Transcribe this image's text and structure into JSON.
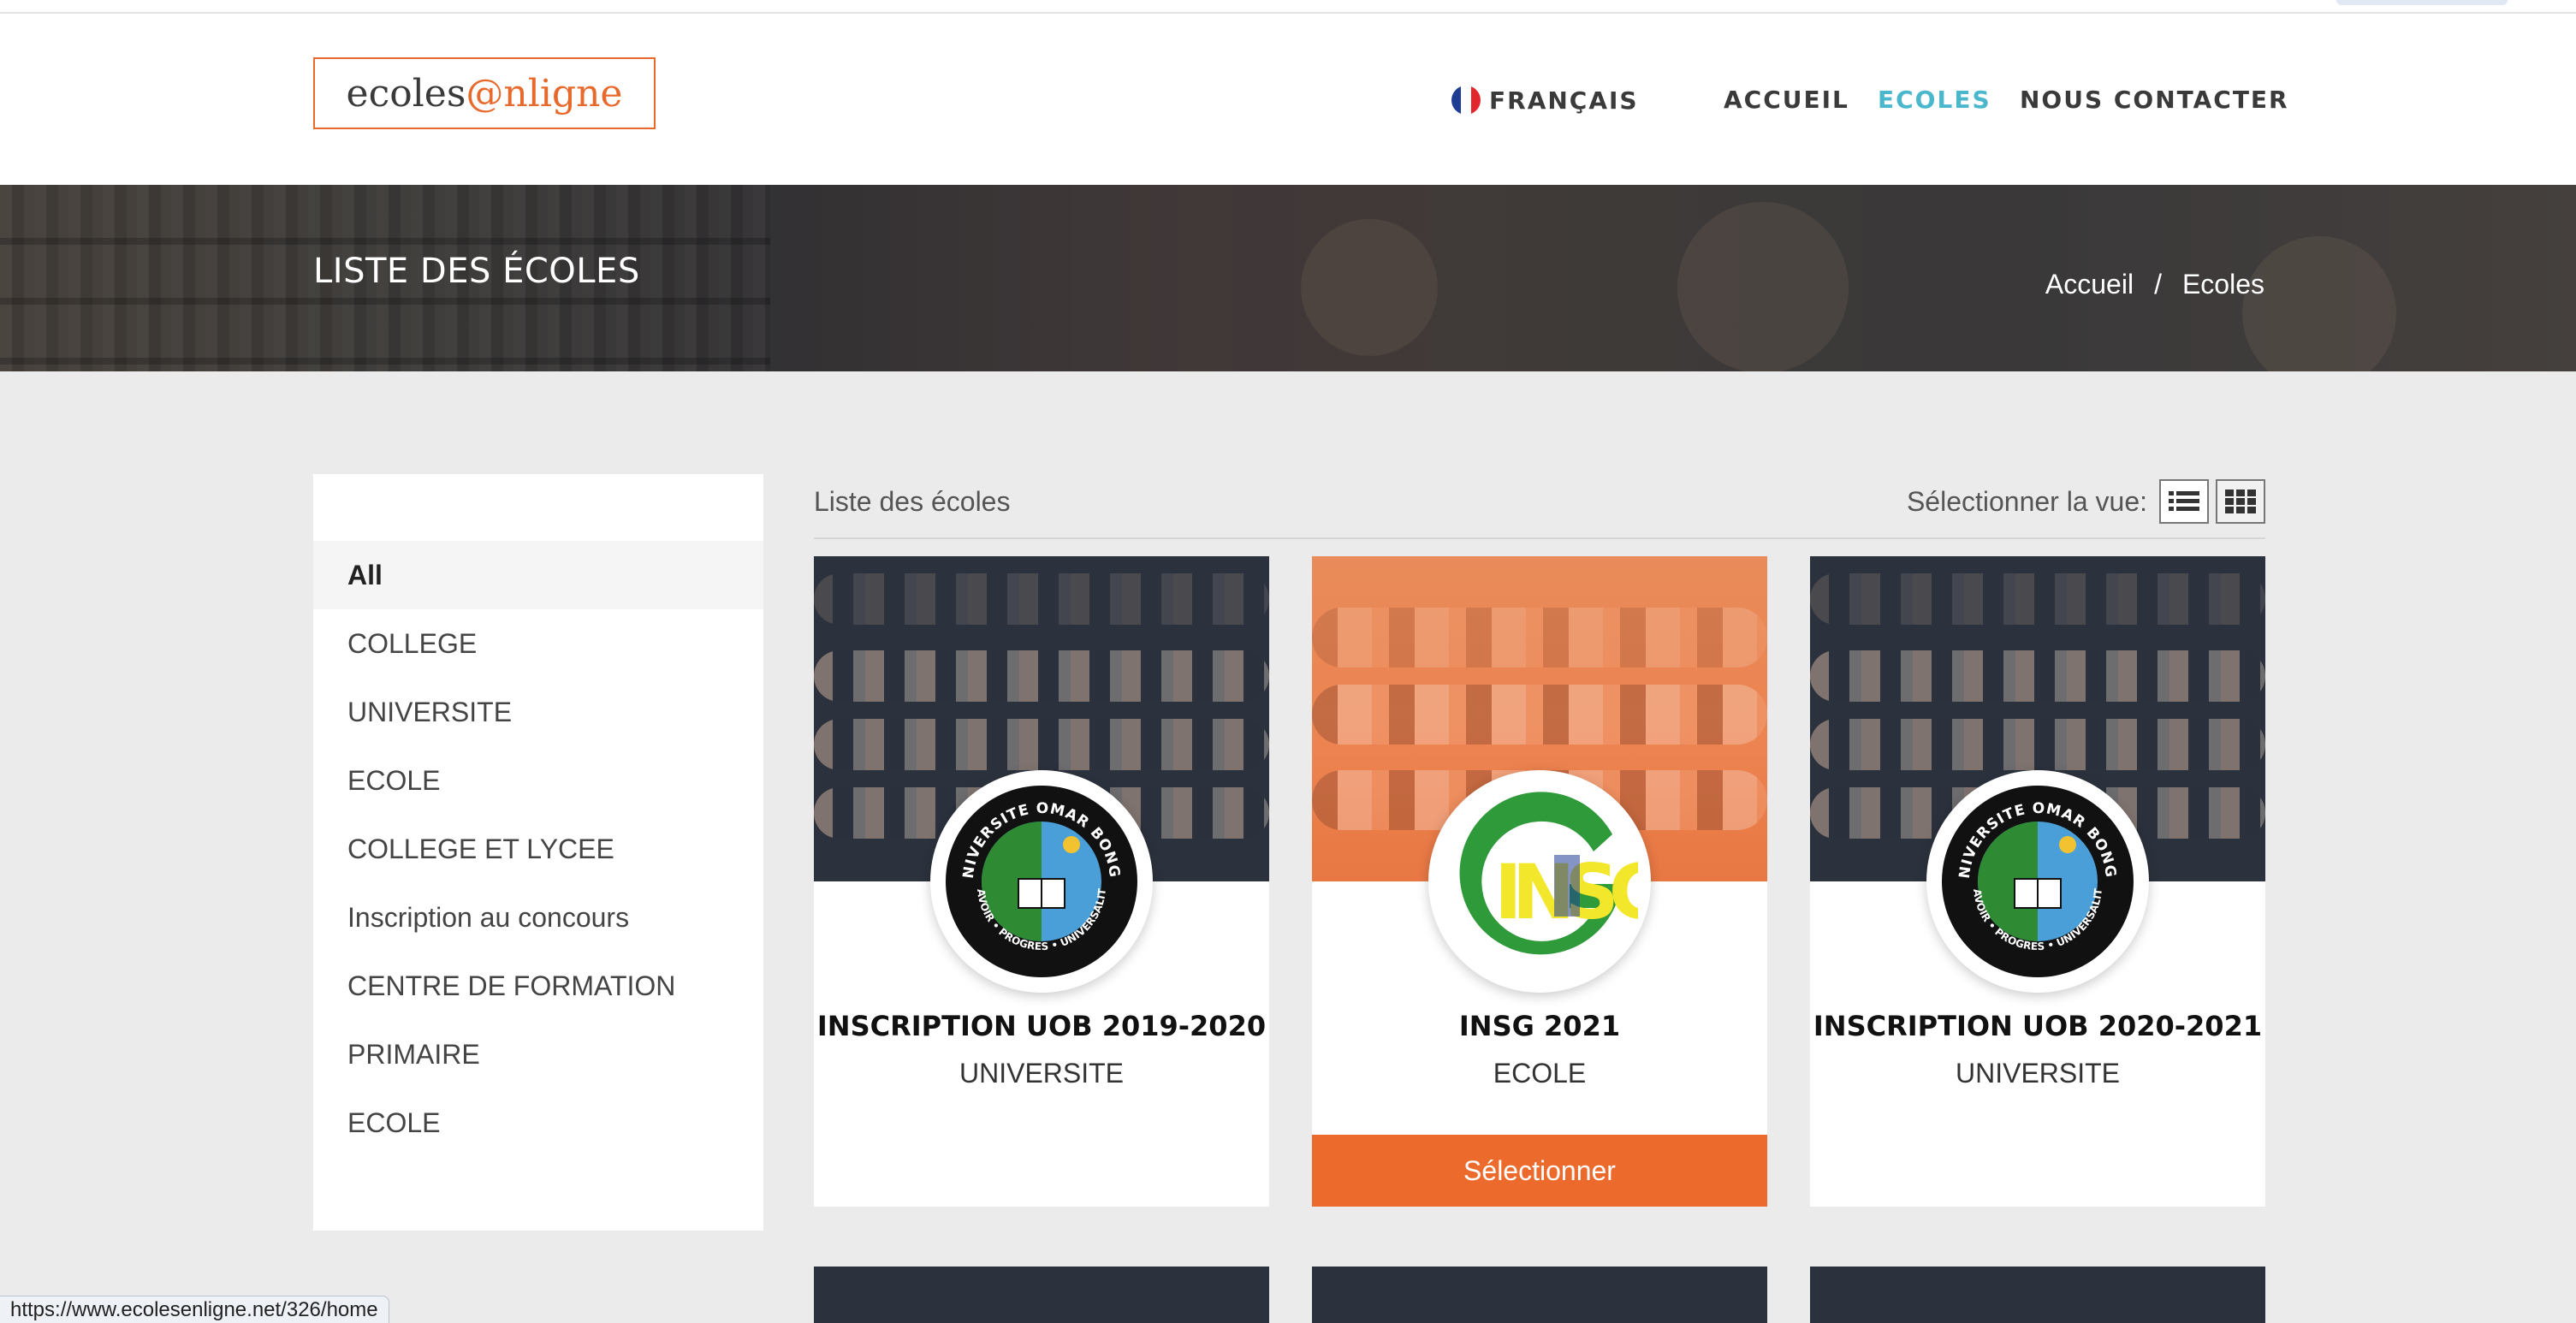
{
  "brand": {
    "logo_text_a": "ecoles",
    "logo_text_b": "@nligne"
  },
  "nav": {
    "language": "FRANÇAIS",
    "home": "ACCUEIL",
    "schools": "ECOLES",
    "contact": "NOUS CONTACTER",
    "active": "ECOLES",
    "active_color": "#4ab7cc"
  },
  "banner": {
    "title": "LISTE DES ÉCOLES",
    "breadcrumb": {
      "home": "Accueil",
      "separator": "/",
      "current": "Ecoles"
    }
  },
  "sidebar": {
    "items": [
      {
        "label": "All",
        "active": true
      },
      {
        "label": "COLLEGE"
      },
      {
        "label": "UNIVERSITE"
      },
      {
        "label": "ECOLE"
      },
      {
        "label": "COLLEGE ET LYCEE"
      },
      {
        "label": "Inscription au concours"
      },
      {
        "label": "CENTRE DE FORMATION"
      },
      {
        "label": "PRIMAIRE"
      },
      {
        "label": "ECOLE"
      }
    ]
  },
  "content": {
    "title": "Liste des écoles",
    "view_label": "Sélectionner la vue:",
    "view_options": [
      "list-view-icon",
      "grid-view-icon"
    ]
  },
  "cards": [
    {
      "name": "INSCRIPTION UOB 2019-2020",
      "type": "UNIVERSITE",
      "logo": "uob-seal-icon"
    },
    {
      "name": "INSG 2021",
      "type": "ECOLE",
      "logo": "insg-logo-icon",
      "button": "Sélectionner"
    },
    {
      "name": "INSCRIPTION UOB 2020-2021",
      "type": "UNIVERSITE",
      "logo": "uob-seal-icon"
    }
  ],
  "seal": {
    "top_text": "UNIVERSITE OMAR BONGO",
    "bottom_text": "SAVOIR • PROGRES • UNIVERSALITE"
  },
  "insg_logo": {
    "letters": "INSG"
  },
  "status_url": "https://www.ecolesenligne.net/326/home",
  "colors": {
    "accent": "#eb6a2c",
    "nav_active": "#4ab7cc",
    "background": "#ebebeb"
  }
}
